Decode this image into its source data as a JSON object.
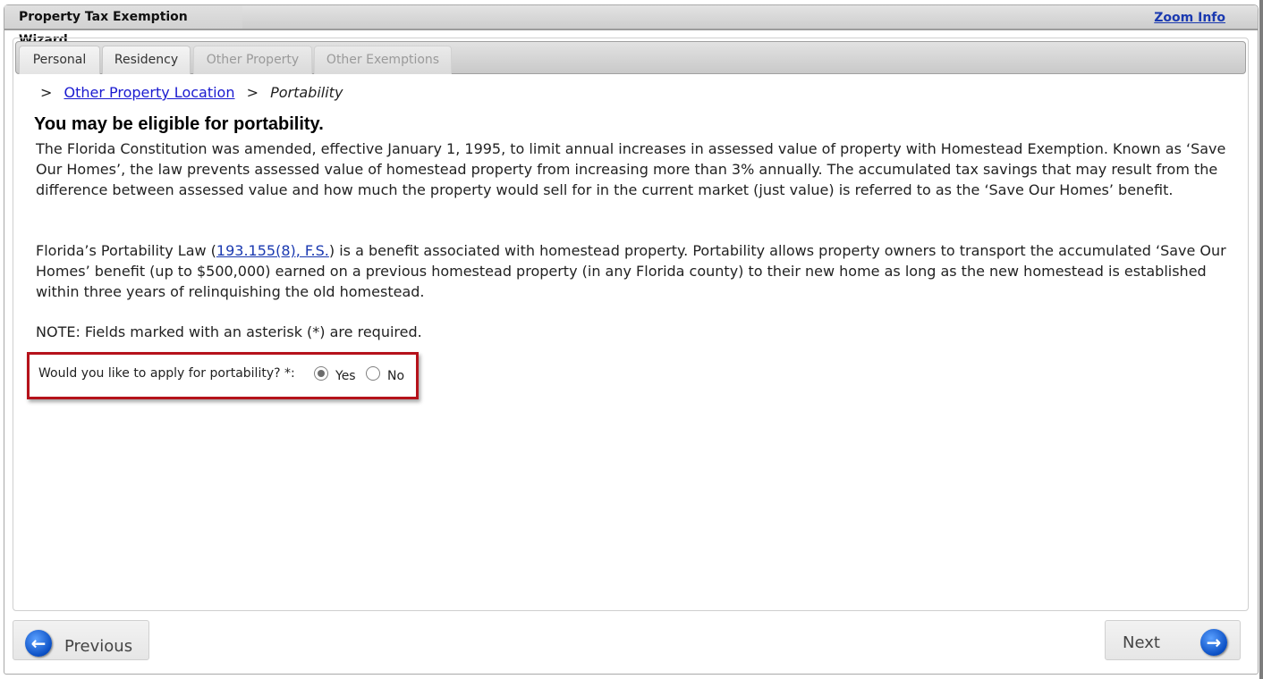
{
  "window": {
    "title": "Property Tax Exemption Wizard",
    "zoom_link": "Zoom Info"
  },
  "tabs": [
    {
      "label": "Personal",
      "state": "enabled"
    },
    {
      "label": "Residency",
      "state": "enabled"
    },
    {
      "label": "Other Property",
      "state": "disabled"
    },
    {
      "label": "Other Exemptions",
      "state": "disabled"
    }
  ],
  "breadcrumb": {
    "separator": ">",
    "link": "Other Property Location",
    "current": "Portability"
  },
  "heading": "You may be eligible for portability.",
  "paragraph1": "The Florida Constitution was amended, effective January 1, 1995, to limit annual increases in assessed value of property with Homestead Exemption. Known as ‘Save Our Homes’, the law prevents assessed value of homestead property from increasing more than 3% annually. The accumulated tax savings that may result from the difference between assessed value and how much the property would sell for in the current market (just value) is referred to as the ‘Save Our Homes’ benefit.",
  "paragraph2": {
    "before": "Florida’s Portability Law (",
    "link": "193.155(8), F.S.",
    "after": ") is a benefit associated with homestead property. Portability allows property owners to transport the accumulated ‘Save Our Homes’ benefit (up to $500,000) earned on a previous homestead property (in any Florida county) to their new home as long as the new homestead is established within three years of relinquishing the old homestead."
  },
  "note": "NOTE: Fields marked with an asterisk (*) are required.",
  "question": {
    "label": "Would you like to apply for portability? *:",
    "options": [
      {
        "label": "Yes",
        "checked": true
      },
      {
        "label": "No",
        "checked": false
      }
    ]
  },
  "buttons": {
    "previous": "Previous",
    "next": "Next"
  },
  "icons": {
    "previous": "arrow-left-circle-icon",
    "next": "arrow-right-circle-icon"
  }
}
